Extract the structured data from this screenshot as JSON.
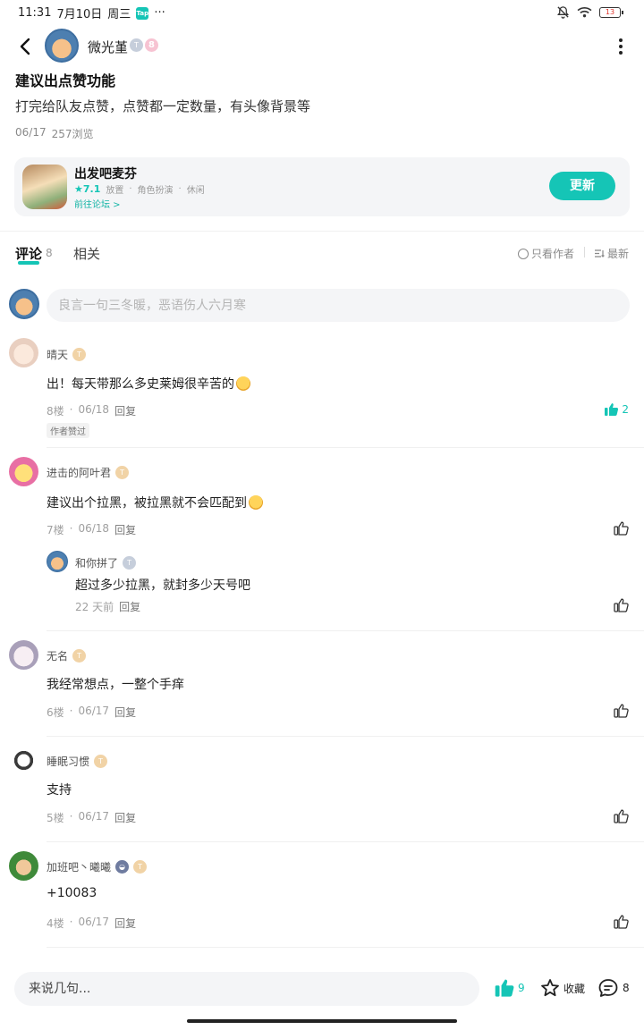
{
  "status_bar": {
    "time": "11:31",
    "date": "7月10日",
    "weekday": "周三",
    "app_badge": "Tap",
    "more": "···",
    "battery": "13"
  },
  "header": {
    "author_name": "微光堇",
    "badge_t": "T",
    "badge_level": "8"
  },
  "post": {
    "title": "建议出点赞功能",
    "body": "打完给队友点赞，点赞都一定数量，有头像背景等",
    "date": "06/17",
    "views": "257浏览"
  },
  "game_card": {
    "name": "出发吧麦芬",
    "rating": "★7.1",
    "tags": [
      "放置",
      "角色扮演",
      "休闲"
    ],
    "forum_link": "前往论坛 >",
    "update_label": "更新"
  },
  "tabs": {
    "comments_label": "评论",
    "comments_count": "8",
    "related_label": "相关",
    "only_author_label": "只看作者",
    "newest_label": "最新"
  },
  "comment_input": {
    "placeholder": "良言一句三冬暖，恶语伤人六月寒"
  },
  "comments": [
    {
      "name": "晴天",
      "text": "出！每天带那么多史莱姆很辛苦的",
      "floor": "8楼",
      "date": "06/18",
      "reply_label": "回复",
      "likes": "2",
      "author_liked": "作者赞过"
    },
    {
      "name": "进击的阿叶君",
      "text": "建议出个拉黑，被拉黑就不会匹配到",
      "floor": "7楼",
      "date": "06/18",
      "reply_label": "回复",
      "reply": {
        "name": "和你拼了",
        "text": "超过多少拉黑，就封多少天号吧",
        "date": "22 天前",
        "reply_label": "回复"
      }
    },
    {
      "name": "无名",
      "text": "我经常想点，一整个手痒",
      "floor": "6楼",
      "date": "06/17",
      "reply_label": "回复"
    },
    {
      "name": "睡眠习惯",
      "text": "支持",
      "floor": "5楼",
      "date": "06/17",
      "reply_label": "回复"
    },
    {
      "name": "加班吧丶曦曦",
      "text": "+10083",
      "floor": "4楼",
      "date": "06/17",
      "reply_label": "回复"
    }
  ],
  "bottom_bar": {
    "placeholder": "来说几句...",
    "like_count": "9",
    "fav_label": "收藏",
    "comment_count": "8"
  },
  "colors": {
    "accent": "#15c5b6",
    "text": "#1a1a1a",
    "muted": "#a0a0a0",
    "surface": "#f4f5f7"
  }
}
